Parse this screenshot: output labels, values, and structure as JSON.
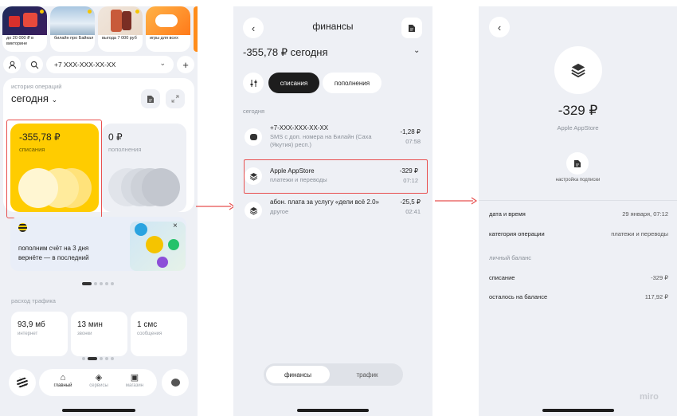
{
  "screen1": {
    "stories": [
      {
        "caption": "до 20 000 ₽ в викторине"
      },
      {
        "caption": "билайн про Байкал"
      },
      {
        "caption": "выгода 7 000 руб"
      },
      {
        "caption": "игры для всех"
      }
    ],
    "phone_selector": {
      "value": "+7 XXX-XXX-XX-XX"
    },
    "history_label": "история операций",
    "period": "сегодня",
    "spending_card": {
      "amount": "-355,78 ₽",
      "label": "списания"
    },
    "topup_card": {
      "amount": "0 ₽",
      "label": "пополнения"
    },
    "promo": {
      "text": "пополним счёт на 3 дня вернёте — в последний"
    },
    "traffic_label": "расход трафика",
    "traffic": [
      {
        "value": "93,9 мб",
        "label": "интернет"
      },
      {
        "value": "13 мин",
        "label": "звонки"
      },
      {
        "value": "1 смс",
        "label": "сообщения"
      }
    ],
    "nav": [
      {
        "label": "главный",
        "active": true
      },
      {
        "label": "сервисы",
        "active": false
      },
      {
        "label": "магазин",
        "active": false
      }
    ]
  },
  "screen2": {
    "title": "финансы",
    "balance_today": "-355,78 ₽ сегодня",
    "filters": [
      {
        "label": "списания",
        "active": true
      },
      {
        "label": "пополнения",
        "active": false
      }
    ],
    "section": "сегодня",
    "transactions": [
      {
        "title": "+7-XXX-XXX-XX-XX",
        "subtitle_lines": [
          "SMS с доп. номера на Билайн (Саха",
          "(Якутия) респ.)"
        ],
        "amount": "-1,28 ₽",
        "time": "07:58",
        "icon": "message-icon",
        "highlighted": false
      },
      {
        "title": "Apple AppStore",
        "subtitle_lines": [
          "платежи и переводы"
        ],
        "amount": "-329 ₽",
        "time": "07:12",
        "icon": "layers-icon",
        "highlighted": true
      },
      {
        "title": "абон. плата за услугу «дели всё 2.0»",
        "subtitle_lines": [
          "другое"
        ],
        "amount": "-25,5 ₽",
        "time": "02:41",
        "icon": "layers-icon",
        "highlighted": false
      }
    ],
    "bottom_tabs": [
      {
        "label": "финансы",
        "active": true
      },
      {
        "label": "трафик",
        "active": false
      }
    ]
  },
  "screen3": {
    "amount": "-329 ₽",
    "merchant": "Apple AppStore",
    "action_label": "настройка подписки",
    "details": [
      {
        "key": "дата и время",
        "value": "29 января, 07:12"
      },
      {
        "key": "категория операции",
        "value": "платежи и переводы"
      }
    ],
    "balance_section": "личный баланс",
    "balance_details": [
      {
        "key": "списание",
        "value": "-329 ₽"
      },
      {
        "key": "осталось на балансе",
        "value": "117,92 ₽"
      }
    ],
    "watermark": "miro"
  },
  "colors": {
    "accent_yellow": "#ffcc00",
    "highlight_red": "#e8504f",
    "background": "#eef0f5",
    "dark": "#1d1d1d"
  }
}
